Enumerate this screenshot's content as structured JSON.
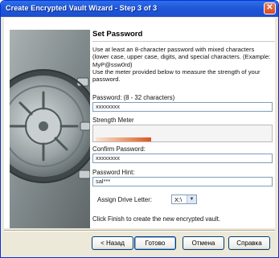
{
  "window": {
    "title": "Create Encrypted Vault Wizard - Step 3 of 3",
    "close_glyph": "✕"
  },
  "page": {
    "heading": "Set Password",
    "description": "Use at least an 8-character password with mixed characters (lower case, upper case, digits, and special characters. (Example: MyP@ssw0rd)\nUse the meter provided below to measure the strength of your password."
  },
  "form": {
    "password_label": "Password: (8 - 32 characters)",
    "password_value": "xxxxxxxx",
    "strength_label": "Strength Meter",
    "strength_level": 0.32,
    "strength_color": "#e0531d",
    "confirm_label": "Confirm Password:",
    "confirm_value": "xxxxxxxx",
    "hint_label": "Password Hint:",
    "hint_value": "sal***",
    "drive_label": "Assign Drive Letter:",
    "drive_value": "X:\\",
    "finish_text": "Click Finish to create the new encrypted vault."
  },
  "buttons": {
    "back": "< Назад",
    "finish": "Готово",
    "cancel": "Отмена",
    "help": "Справка"
  },
  "colors": {
    "titlebar": "#1f55d6",
    "dialog_bg": "#ece9d8",
    "input_border": "#7f9db9"
  }
}
